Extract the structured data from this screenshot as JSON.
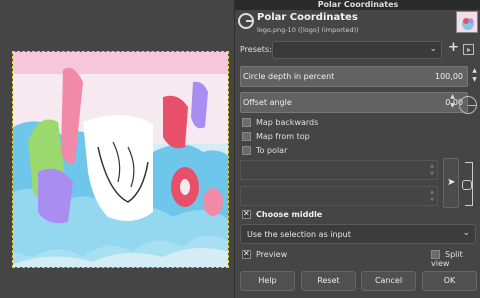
{
  "dialog": {
    "window_title": "Polar Coordinates",
    "title": "Polar Coordinates",
    "subtitle": "logo.png-10 ([logo] (imported))",
    "presets_label": "Presets:",
    "presets_value": "",
    "circle_depth": {
      "label": "Circle depth in percent",
      "value": "100,00"
    },
    "offset_angle": {
      "label": "Offset angle",
      "value": "0,00"
    },
    "map_backwards": {
      "label": "Map backwards",
      "checked": false
    },
    "map_from_top": {
      "label": "Map from top",
      "checked": false
    },
    "to_polar": {
      "label": "To polar",
      "checked": false
    },
    "choose_middle": {
      "label": "Choose middle",
      "checked": true
    },
    "middle_mode": "Use the selection as input",
    "preview": {
      "label": "Preview",
      "checked": true
    },
    "split_view": {
      "label": "Split view",
      "checked": false
    },
    "buttons": {
      "help": "Help",
      "reset": "Reset",
      "cancel": "Cancel",
      "ok": "OK"
    }
  },
  "icons": [
    "gimp-logo-icon",
    "preset-add-icon",
    "preset-menu-icon",
    "dial-icon",
    "pointer-picker-icon",
    "chain-link-icon",
    "chevron-down-icon"
  ],
  "colors": {
    "dialog_bg": "#454545",
    "titlebar_bg": "#2b2b2b",
    "selection_border": "#e8d23a"
  }
}
